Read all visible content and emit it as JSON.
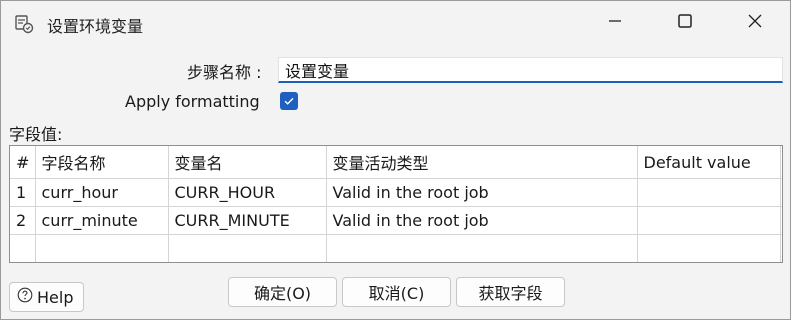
{
  "window": {
    "title": "设置环境变量",
    "icons": {
      "app": "settings-variable-icon",
      "minimize": "minimize-icon",
      "maximize": "maximize-icon",
      "close": "close-icon"
    }
  },
  "form": {
    "step_name_label": "步骤名称 :",
    "step_name_value": "设置变量",
    "apply_formatting_label": "Apply formatting",
    "apply_formatting_checked": true,
    "fields_label": "字段值:"
  },
  "table": {
    "headers": [
      "#",
      "字段名称",
      "变量名",
      "变量活动类型",
      "Default value"
    ],
    "rows": [
      {
        "num": "1",
        "field": "curr_hour",
        "variable": "CURR_HOUR",
        "type": "Valid in the root job",
        "default": ""
      },
      {
        "num": "2",
        "field": "curr_minute",
        "variable": "CURR_MINUTE",
        "type": "Valid in the root job",
        "default": ""
      }
    ]
  },
  "buttons": {
    "help": "Help",
    "ok": "确定(O)",
    "cancel": "取消(C)",
    "get_fields": "获取字段"
  },
  "colors": {
    "accent": "#1f5fbf"
  }
}
